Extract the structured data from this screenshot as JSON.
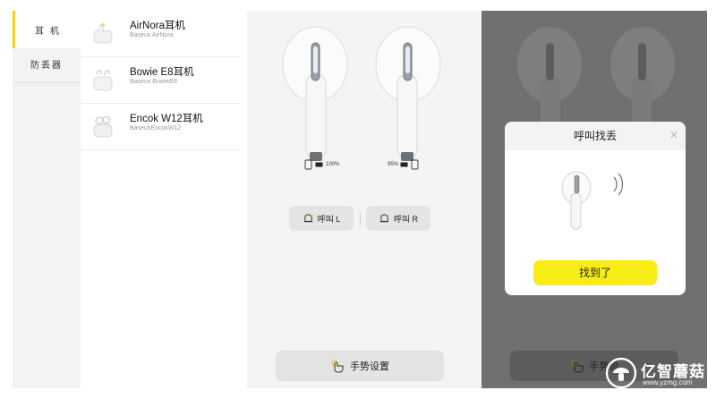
{
  "sidebar": {
    "items": [
      {
        "label": "耳 机",
        "active": true
      },
      {
        "label": "防丢器",
        "active": false
      }
    ],
    "accent_color": "#f5d60a"
  },
  "devices": [
    {
      "name": "AirNora耳机",
      "subtitle": "Baseus AirNora"
    },
    {
      "name": "Bowie E8耳机",
      "subtitle": "Baseus BowieE8"
    },
    {
      "name": "Encok W12耳机",
      "subtitle": "BaseusEncokW12"
    }
  ],
  "earbuds": {
    "left_battery": "100%",
    "right_battery": "95%",
    "call_left_label": "呼叫 L",
    "call_right_label": "呼叫 R",
    "gesture_label": "手势设置"
  },
  "dialog": {
    "title": "呼叫找丢",
    "close_icon": "close-icon",
    "found_label": "找到了",
    "button_color": "#f7ec16"
  },
  "overlay": {
    "gesture_label": "手势设"
  },
  "watermark": {
    "title": "亿智蘑菇",
    "url": "www.yzmg.com"
  }
}
